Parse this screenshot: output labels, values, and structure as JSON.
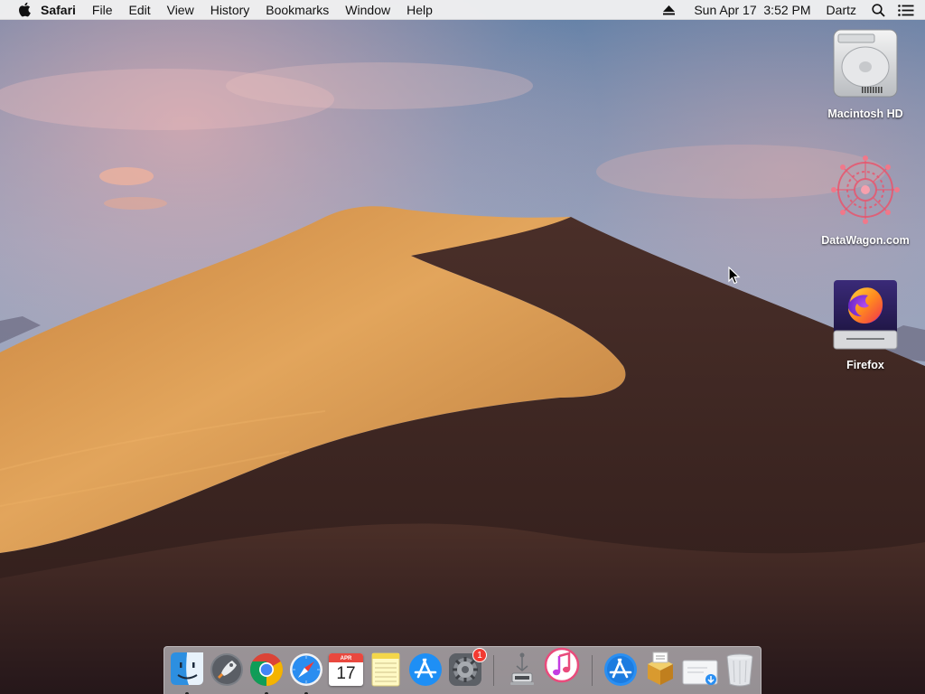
{
  "menubar": {
    "app_name": "Safari",
    "menus": [
      "File",
      "Edit",
      "View",
      "History",
      "Bookmarks",
      "Window",
      "Help"
    ],
    "datetime": "Sun Apr 17  3:52 PM",
    "user": "Dartz"
  },
  "desktop_icons": [
    {
      "label": "Macintosh HD",
      "icon": "hard-drive-icon"
    },
    {
      "label": "DataWagon.com",
      "icon": "datawagon-icon"
    },
    {
      "label": "Firefox",
      "icon": "firefox-disk-icon"
    }
  ],
  "dock": {
    "apps": [
      {
        "name": "Finder",
        "icon": "finder-icon",
        "running": true
      },
      {
        "name": "Launchpad",
        "icon": "launchpad-icon",
        "running": false
      },
      {
        "name": "Google Chrome",
        "icon": "chrome-icon",
        "running": true
      },
      {
        "name": "Safari",
        "icon": "safari-icon",
        "running": true
      },
      {
        "name": "Calendar",
        "icon": "calendar-icon",
        "running": false,
        "month": "APR",
        "day": "17"
      },
      {
        "name": "Notes",
        "icon": "notes-icon",
        "running": false
      },
      {
        "name": "App Store",
        "icon": "app-store-icon",
        "running": false
      },
      {
        "name": "System Preferences",
        "icon": "system-preferences-icon",
        "running": false,
        "badge": "1"
      },
      {
        "name": "Migration Assistant",
        "icon": "migration-assistant-icon",
        "running": false
      },
      {
        "name": "iTunes",
        "icon": "itunes-icon",
        "running": false
      },
      {
        "name": "Applications",
        "icon": "applications-folder-icon",
        "running": false
      },
      {
        "name": "Installer",
        "icon": "installer-icon",
        "running": false
      },
      {
        "name": "Downloads",
        "icon": "downloads-stack-icon",
        "running": false
      },
      {
        "name": "Trash",
        "icon": "trash-icon",
        "running": false
      }
    ]
  },
  "colors": {
    "menubar_bg": "#f0f0f0",
    "dune_light": "#d99a4e",
    "dune_shadow": "#3a2420",
    "sky_top": "#5f7ea3",
    "badge": "#f23a32"
  }
}
